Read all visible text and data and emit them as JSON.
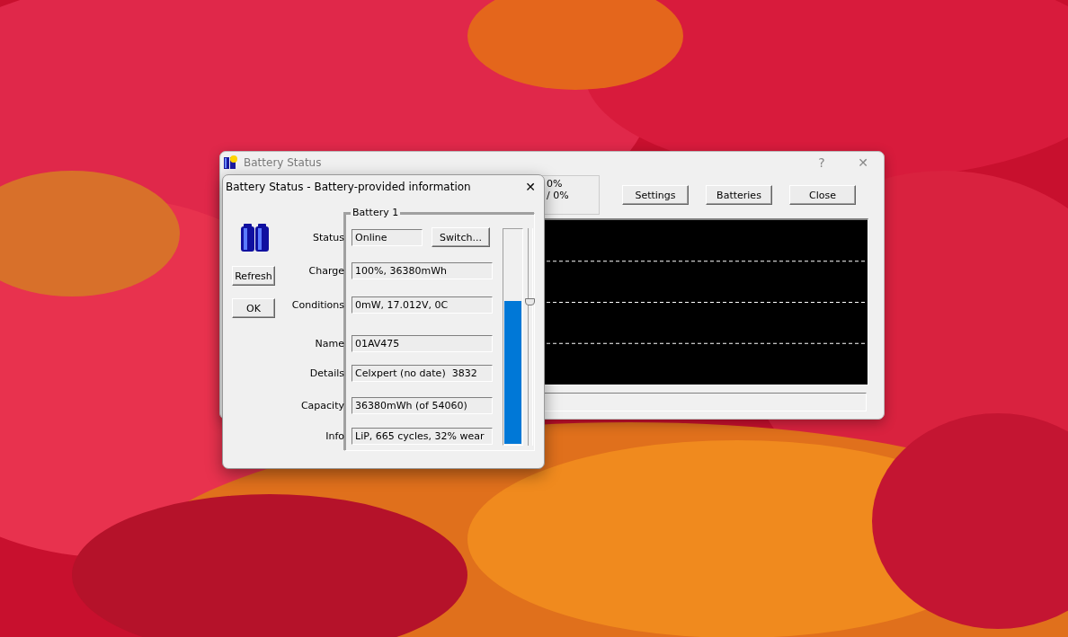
{
  "main_window": {
    "title": "Battery Status",
    "help": "?",
    "close": "✕",
    "summary_lines": [
      "0%",
      "/ 0%"
    ],
    "buttons": [
      "Settings",
      "Batteries",
      "Close"
    ]
  },
  "dialog": {
    "title": "Battery Status - Battery-provided information",
    "close": "✕",
    "buttons": [
      "Refresh",
      "OK"
    ],
    "group_title": "Battery 1",
    "rows": [
      {
        "label": "Status",
        "value": "Online",
        "action": "Switch..."
      },
      {
        "label": "Charge",
        "value": "100%, 36380mWh"
      },
      {
        "label": "Conditions",
        "value": "0mW, 17.012V, 0C"
      },
      {
        "label": "Name",
        "value": "01AV475"
      },
      {
        "label": "Details",
        "value": "Celxpert (no date)  3832"
      },
      {
        "label": "Capacity",
        "value": "36380mWh (of 54060)"
      },
      {
        "label": "Info",
        "value": "LiP, 665 cycles, 32% wear"
      }
    ],
    "charge_meter": {
      "level": 0.67
    },
    "slider": {
      "level": 0.67
    }
  }
}
